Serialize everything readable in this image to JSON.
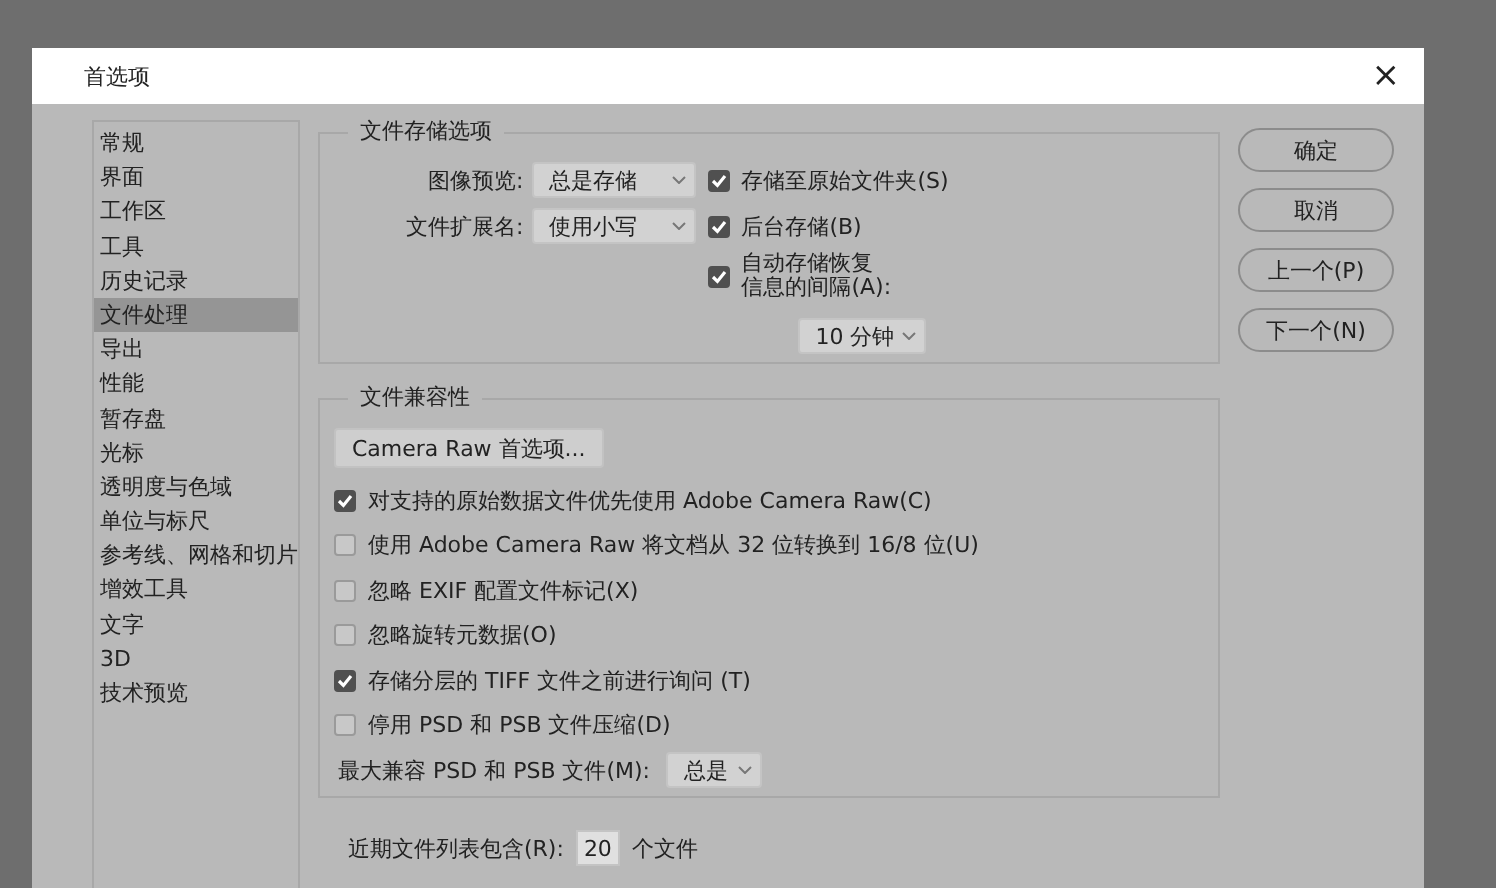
{
  "window": {
    "title": "首选项",
    "close": "×"
  },
  "sidebar": {
    "items": [
      {
        "label": "常规",
        "selected": false
      },
      {
        "label": "界面",
        "selected": false
      },
      {
        "label": "工作区",
        "selected": false
      },
      {
        "label": "工具",
        "selected": false
      },
      {
        "label": "历史记录",
        "selected": false
      },
      {
        "label": "文件处理",
        "selected": true
      },
      {
        "label": "导出",
        "selected": false
      },
      {
        "label": "性能",
        "selected": false
      },
      {
        "label": "暂存盘",
        "selected": false
      },
      {
        "label": "光标",
        "selected": false
      },
      {
        "label": "透明度与色域",
        "selected": false
      },
      {
        "label": "单位与标尺",
        "selected": false
      },
      {
        "label": "参考线、网格和切片",
        "selected": false
      },
      {
        "label": "增效工具",
        "selected": false
      },
      {
        "label": "文字",
        "selected": false
      },
      {
        "label": "3D",
        "selected": false
      },
      {
        "label": "技术预览",
        "selected": false
      }
    ]
  },
  "file_save": {
    "title": "文件存储选项",
    "selects": [
      {
        "label": "图像预览:",
        "value": "总是存储"
      },
      {
        "label": "文件扩展名:",
        "value": "使用小写"
      }
    ],
    "checks": [
      {
        "label": "存储至原始文件夹(S)",
        "checked": true
      },
      {
        "label": "后台存储(B)",
        "checked": true
      },
      {
        "label": "自动存储恢复",
        "label_line_2": "信息的间隔(A):",
        "checked": true
      }
    ],
    "interval": "10 分钟"
  },
  "compat": {
    "title": "文件兼容性",
    "button": "Camera Raw 首选项...",
    "checks": [
      {
        "label": "对支持的原始数据文件优先使用 Adobe Camera Raw(C)",
        "checked": true
      },
      {
        "label": "使用 Adobe Camera Raw 将文档从 32 位转换到 16/8 位(U)",
        "checked": false
      },
      {
        "label": "忽略 EXIF 配置文件标记(X)",
        "checked": false
      },
      {
        "label": "忽略旋转元数据(O)",
        "checked": false
      },
      {
        "label": "存储分层的 TIFF 文件之前进行询问 (T)",
        "checked": true
      },
      {
        "label": "停用 PSD 和 PSB 文件压缩(D)",
        "checked": false
      }
    ],
    "max_compat": {
      "label": "最大兼容 PSD 和 PSB 文件(M):",
      "value": "总是"
    }
  },
  "recent": {
    "label": "近期文件列表包含(R):",
    "value": "20",
    "suffix": "个文件"
  },
  "buttons": [
    "确定",
    "取消",
    "上一个(P)",
    "下一个(N)"
  ]
}
